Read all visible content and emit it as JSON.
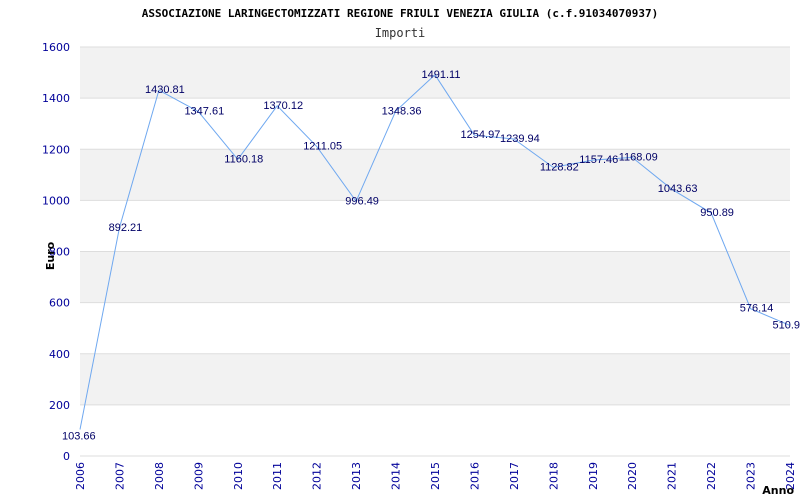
{
  "chart_data": {
    "type": "line",
    "title": "ASSOCIAZIONE LARINGECTOMIZZATI REGIONE FRIULI VENEZIA GIULIA (c.f.91034070937)",
    "subtitle": "Importi",
    "xlabel": "Anno",
    "ylabel": "Euro",
    "ylim": [
      0,
      1600
    ],
    "yticks": [
      "0",
      "200",
      "400",
      "600",
      "800",
      "1000",
      "1200",
      "1400",
      "1600"
    ],
    "categories": [
      "2006",
      "2007",
      "2008",
      "2009",
      "2010",
      "2011",
      "2012",
      "2013",
      "2014",
      "2015",
      "2016",
      "2017",
      "2018",
      "2019",
      "2020",
      "2021",
      "2022",
      "2023",
      "2024"
    ],
    "values": [
      103.66,
      892.21,
      1430.81,
      1347.61,
      1160.18,
      1370.12,
      1211.05,
      996.49,
      1348.36,
      1491.11,
      1254.97,
      1239.94,
      1128.82,
      1157.46,
      1168.09,
      1043.63,
      950.89,
      576.14,
      510.9
    ],
    "labels": [
      "103.66",
      "892.21",
      "1430.81",
      "1347.61",
      "1160.18",
      "1370.12",
      "1211.05",
      "996.49",
      "1348.36",
      "1491.11",
      "1254.97",
      "1239.94",
      "1128.82",
      "1157.46",
      "1168.09",
      "1043.63",
      "950.89",
      "576.14",
      "510.9"
    ],
    "grid": true,
    "colors": {
      "line": "#6fa8f0",
      "band": "#f2f2f2",
      "grid": "#dddddd",
      "axis_text": "#000099",
      "data_label": "#000066"
    }
  }
}
